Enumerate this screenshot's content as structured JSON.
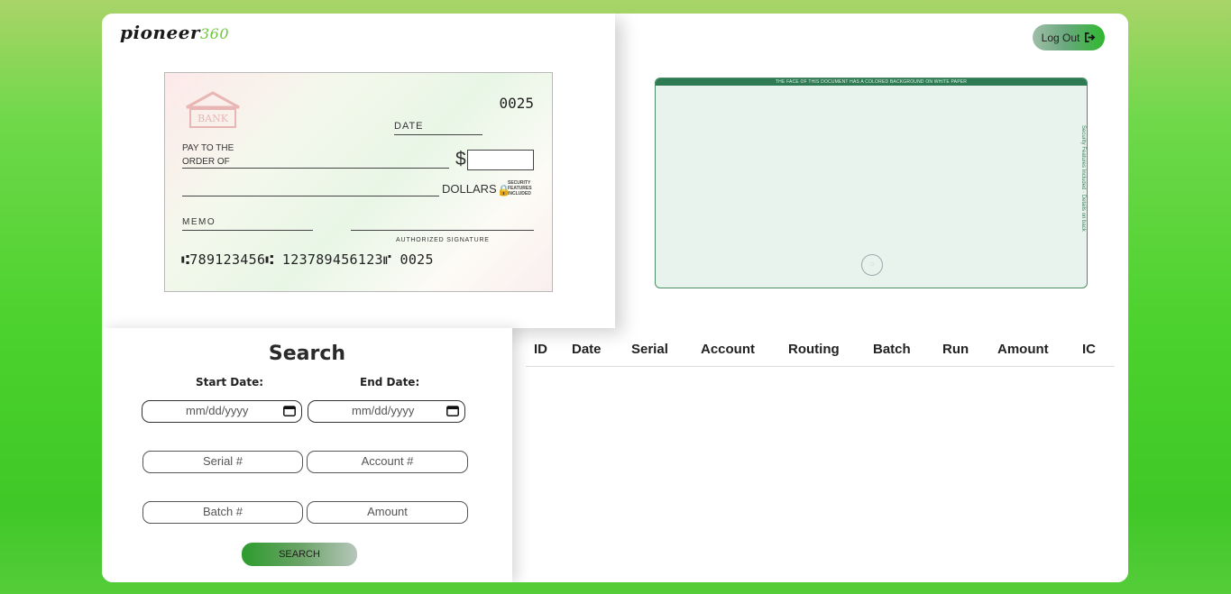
{
  "brand": {
    "name": "pioneer",
    "suffix": "360"
  },
  "header": {
    "logout_label": "Log Out",
    "logout_icon": "sign-out-icon"
  },
  "check_front": {
    "bank_label": "BANK",
    "check_number": "0025",
    "date_label": "DATE",
    "pay_to_line1": "PAY TO THE",
    "pay_to_line2": "ORDER OF",
    "dollar_sign": "$",
    "dollars_label": "DOLLARS",
    "security_text": "SECURITY FEATURES INCLUDED",
    "memo_label": "MEMO",
    "signature_label": "AUTHORIZED SIGNATURE",
    "micr_line": "⑆789123456⑆ 123789456123⑈ 0025"
  },
  "check_back": {
    "top_text": "THE FACE OF THIS DOCUMENT HAS A COLORED BACKGROUND ON WHITE PAPER",
    "side_text": "Security Features Included · Details on back"
  },
  "search": {
    "title": "Search",
    "start_date_label": "Start Date:",
    "end_date_label": "End Date:",
    "start_date_placeholder": "mm/dd/yyyy",
    "end_date_placeholder": "mm/dd/yyyy",
    "serial_placeholder": "Serial #",
    "account_placeholder": "Account #",
    "batch_placeholder": "Batch #",
    "amount_placeholder": "Amount",
    "button_label": "SEARCH"
  },
  "table": {
    "columns": [
      "ID",
      "Date",
      "Serial",
      "Account",
      "Routing",
      "Batch",
      "Run",
      "Amount",
      "IC"
    ],
    "rows": []
  },
  "colors": {
    "accent": "#3fc827",
    "check_back_band": "#2d7a53"
  }
}
